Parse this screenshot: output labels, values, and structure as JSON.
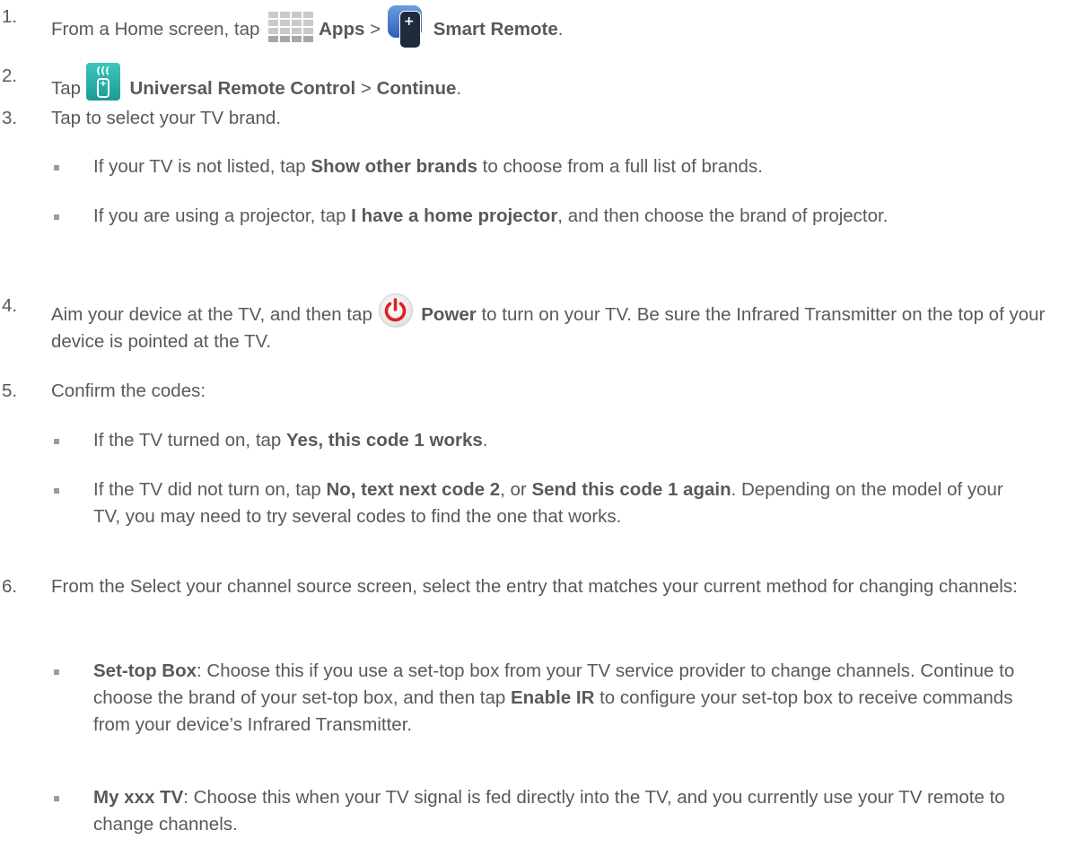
{
  "steps": [
    {
      "num": "1.",
      "t1": "From a Home screen, tap ",
      "b1": "Apps",
      "t2": " > ",
      "b2": "Smart Remote",
      "t3": "."
    },
    {
      "num": "2.",
      "t1": "Tap ",
      "b1": "Universal Remote Control",
      "t2": " > ",
      "b2": "Continue",
      "t3": "."
    },
    {
      "num": "3.",
      "t1": "Tap to select your TV brand."
    },
    {
      "num": "4.",
      "t1": "Aim your device at the TV, and then tap ",
      "b1": "Power",
      "t2": " to turn on your TV. Be sure the Infrared Transmitter on the top of your device is pointed at the TV."
    },
    {
      "num": "5.",
      "t1": "Confirm the codes:"
    },
    {
      "num": "6.",
      "t1": "From the Select your channel source screen, select the entry that matches your current method for changing channels:"
    }
  ],
  "step3_bullets": [
    {
      "t1": "If your TV is not listed, tap ",
      "b1": "Show other brands",
      "t2": " to choose from a full list of brands."
    },
    {
      "t1": "If you are using a projector, tap ",
      "b1": "I have a home projector",
      "t2": ", and then choose the brand of projector."
    }
  ],
  "step5_bullets": [
    {
      "t1": "If the TV turned on, tap ",
      "b1": "Yes, this code 1 works",
      "t2": "."
    },
    {
      "t1": "If the TV did not turn on, tap ",
      "b1": "No, text next code 2",
      "t2": ", or ",
      "b2": "Send this code 1 again",
      "t3": ". Depending on the model of your TV, you may need to try several codes to find the one that works."
    }
  ],
  "step6_bullets": [
    {
      "b1": "Set-top Box",
      "t1": ": Choose this if you use a set-top box from your TV service provider to change channels. Continue to choose the brand of your set-top box, and then tap ",
      "b2": "Enable IR",
      "t2": " to configure your set-top box to receive commands from your device’s Infrared Transmitter."
    },
    {
      "b1": "My xxx TV",
      "t1": ": Choose this when your TV signal is fed directly into the TV, and you currently use your TV remote to change channels."
    }
  ],
  "icons": {
    "apps": "apps-grid-icon",
    "smart_remote": "smart-remote-icon",
    "universal_remote": "universal-remote-icon",
    "power": "power-icon"
  },
  "colors": {
    "text": "#58595b",
    "power_red": "#e02020",
    "remote_blue": "#3a6cc6",
    "universal_teal": "#27b0a8"
  }
}
